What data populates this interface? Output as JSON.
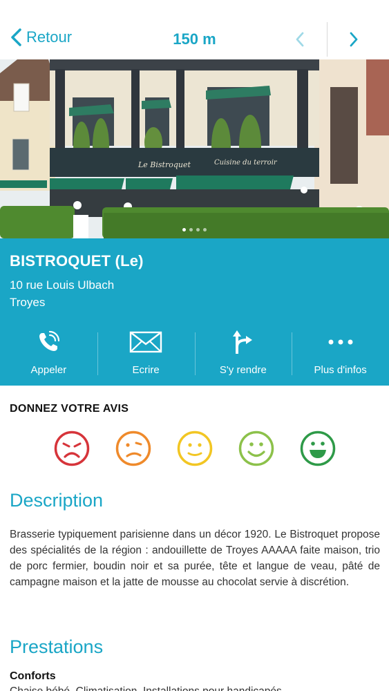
{
  "topbar": {
    "back_label": "Retour",
    "distance": "150 m"
  },
  "gallery": {
    "count": 4,
    "active_index": 0
  },
  "place": {
    "name": "BISTROQUET (Le)",
    "street": "10 rue Louis Ulbach",
    "city": "Troyes"
  },
  "actions": [
    {
      "label": "Appeler",
      "icon": "phone-icon"
    },
    {
      "label": "Ecrire",
      "icon": "envelope-icon"
    },
    {
      "label": "S'y rendre",
      "icon": "directions-icon"
    },
    {
      "label": "Plus d'infos",
      "icon": "more-dots-icon"
    }
  ],
  "rating": {
    "title": "DONNEZ VOTRE AVIS",
    "faces": [
      {
        "name": "very-unhappy-face-icon",
        "color": "#d6343a"
      },
      {
        "name": "unhappy-face-icon",
        "color": "#ef8a2b"
      },
      {
        "name": "neutral-face-icon",
        "color": "#f2c623"
      },
      {
        "name": "happy-face-icon",
        "color": "#8cc14a"
      },
      {
        "name": "very-happy-face-icon",
        "color": "#2e9a48"
      }
    ]
  },
  "description": {
    "title": "Description",
    "text": "Brasserie typiquement parisienne dans un décor 1920. Le Bistroquet propose des spécialités de la région : andouillette de Troyes AAAAA faite maison, trio de porc fermier, boudin noir et sa purée, tête et langue de veau, pâté de campagne maison et la jatte de mousse au chocolat servie à discrétion."
  },
  "prestations": {
    "title": "Prestations",
    "conforts_label": "Conforts",
    "conforts_text": "Chaise bébé, Climatisation, Installations pour handicapés"
  },
  "colors": {
    "accent": "#1aa6c6",
    "text": "#333333"
  }
}
